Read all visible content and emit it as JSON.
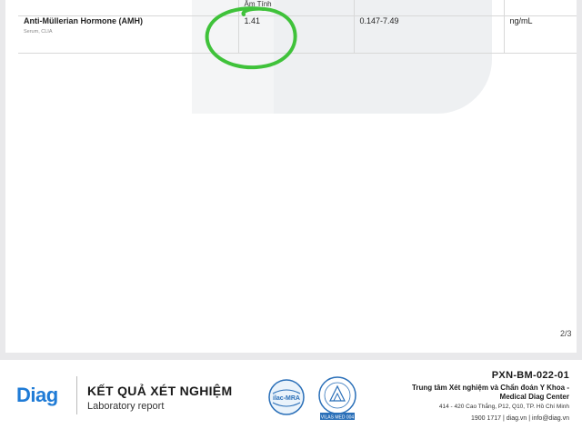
{
  "table": {
    "header_fragment": "Âm Tính",
    "row": {
      "test_name": "Anti-Müllerian Hormone (AMH)",
      "test_meta": "Serum, CLIA",
      "result": "1.41",
      "reference_range": "0.147-7.49",
      "unit": "ng/mL"
    }
  },
  "page_number": "2/3",
  "footer": {
    "brand": "Diag",
    "title_vn": "KẾT QUẢ XÉT NGHIỆM",
    "title_en": "Laboratory report",
    "logo1_text": "ilac-MRA",
    "logo2_text": "VILAS MED 004",
    "doc_code": "PXN-BM-022-01",
    "center_name": "Trung tâm Xét nghiệm và Chẩn đoán Y Khoa - Medical Diag Center",
    "address": "414 - 420 Cao Thắng, P12, Q10, TP. Hồ Chí Minh",
    "contact": "1900 1717 | diag.vn | info@diag.vn"
  },
  "colors": {
    "brand_blue": "#1f7bd6",
    "circle_green": "#3fc23a"
  }
}
